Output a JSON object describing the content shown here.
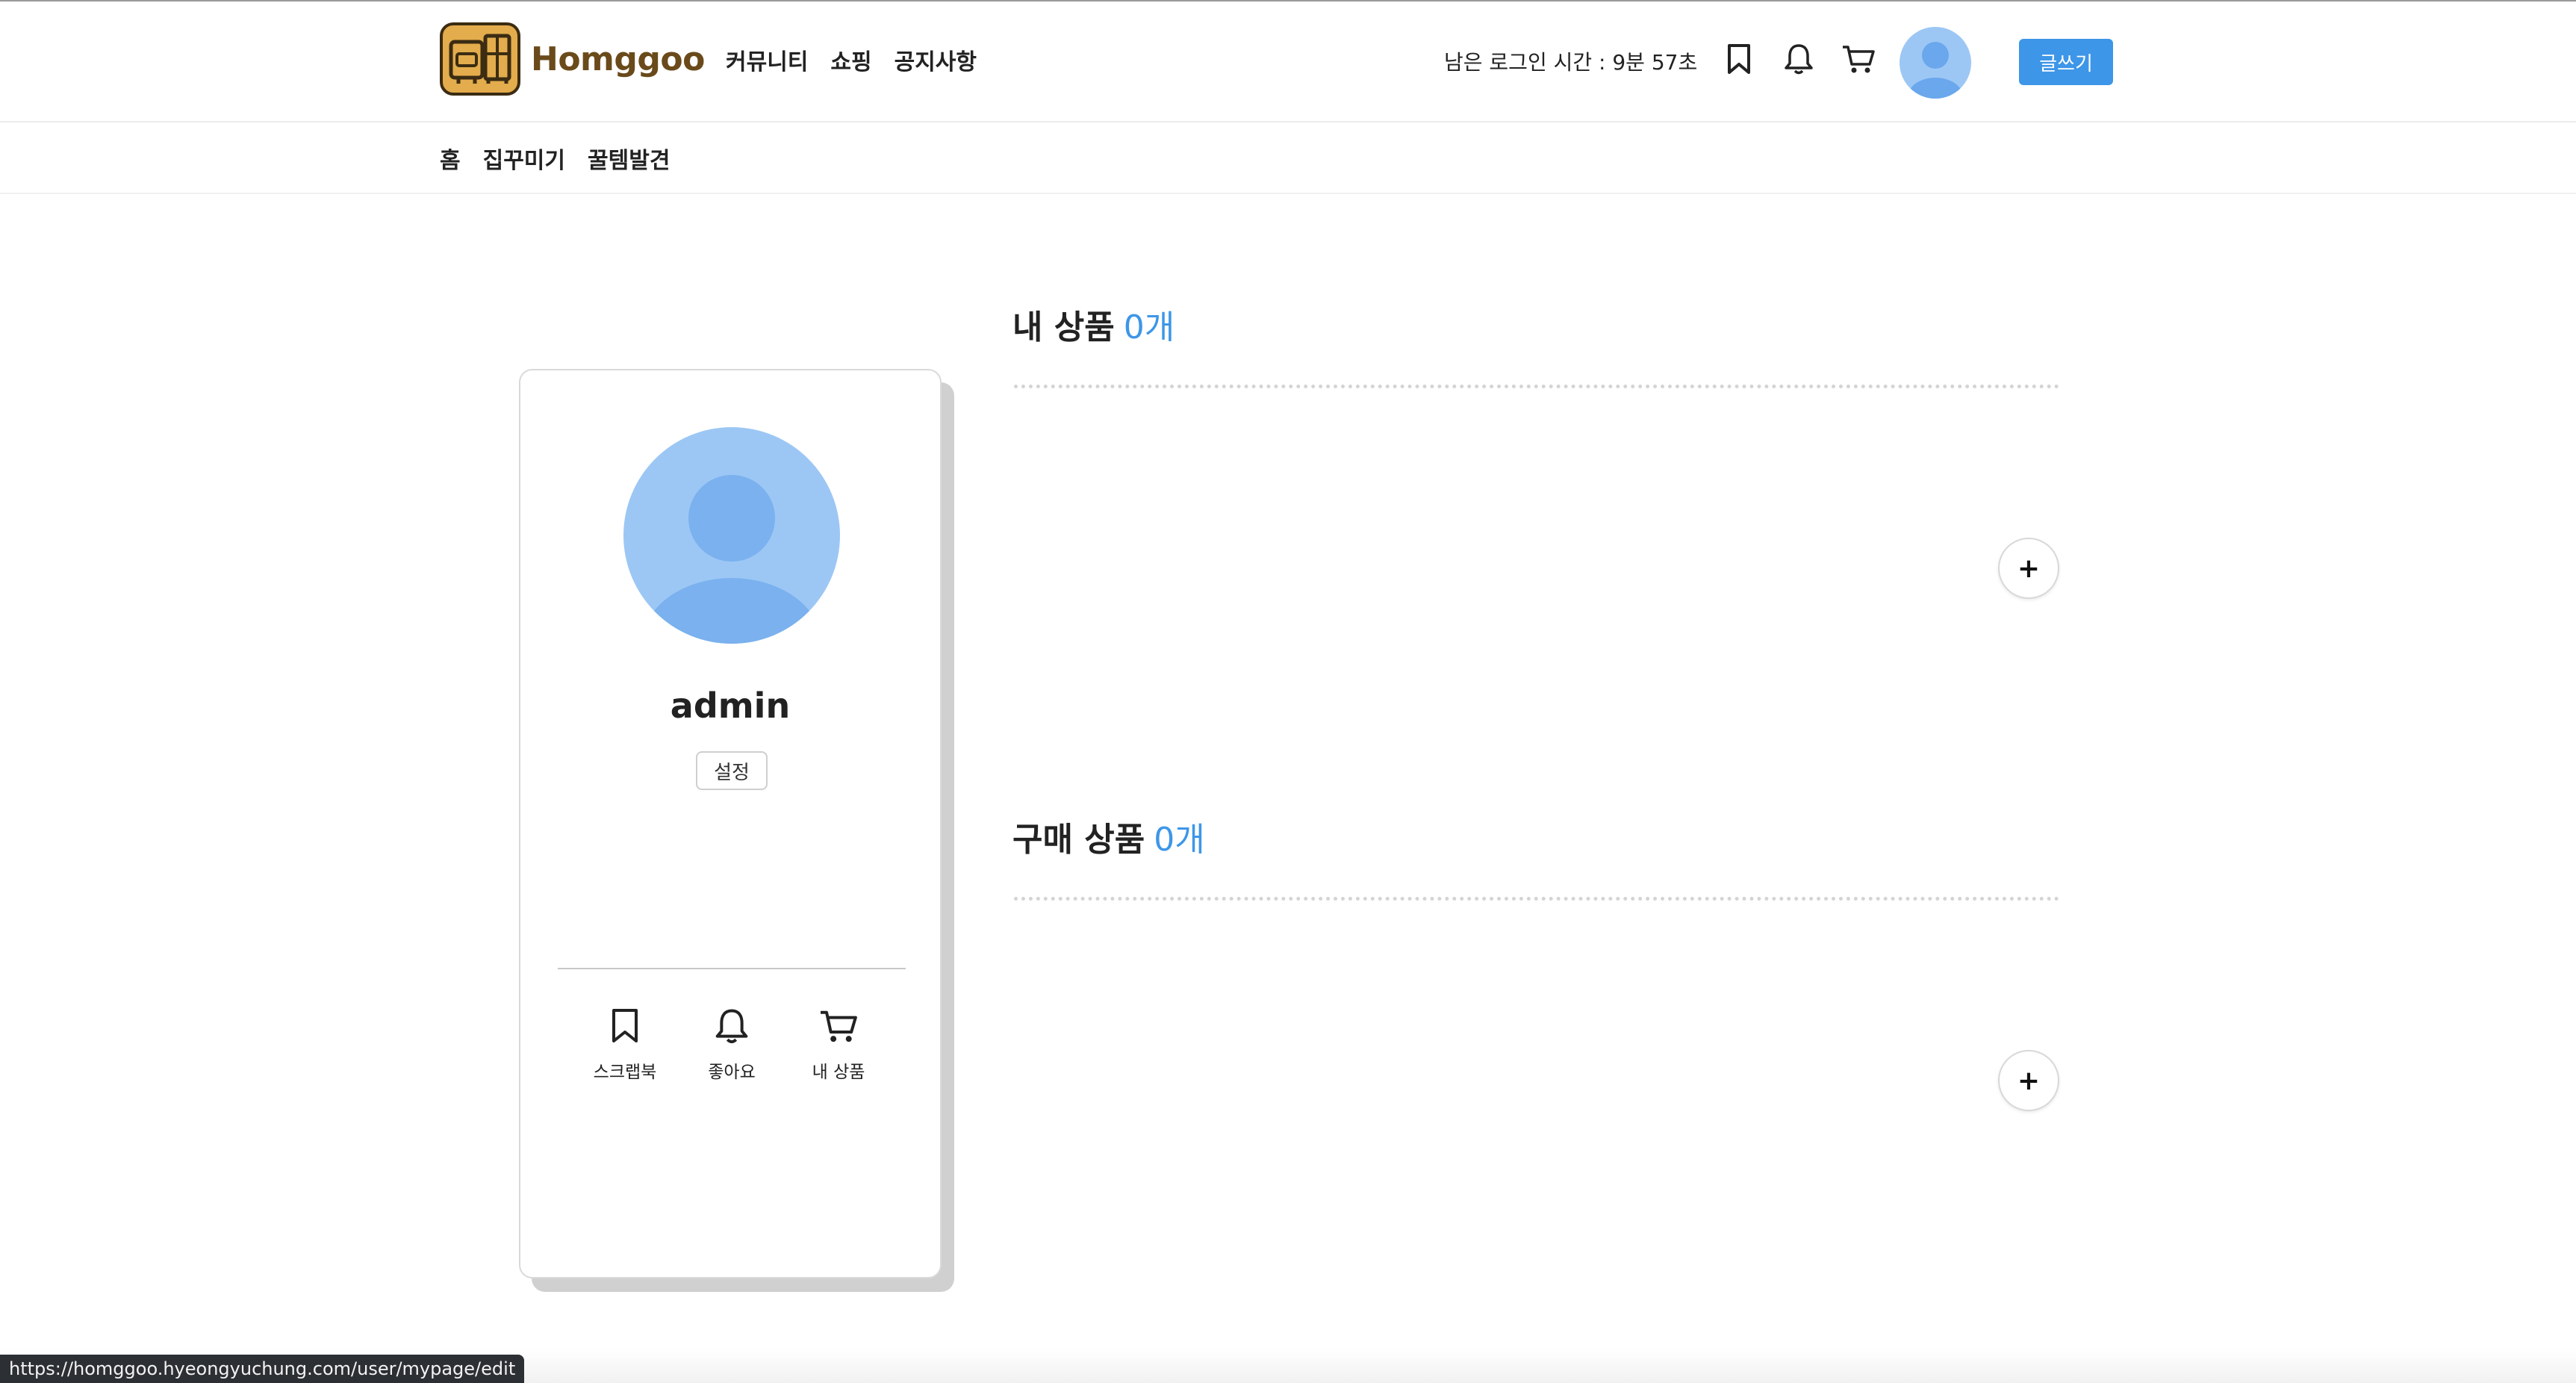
{
  "brand": {
    "name": "Homggoo"
  },
  "header": {
    "nav": [
      "커뮤니티",
      "쇼핑",
      "공지사항"
    ],
    "login_timer": "남은 로그인 시간 : 9분 57초",
    "write_label": "글쓰기"
  },
  "subnav": [
    "홈",
    "집꾸미기",
    "꿀템발견"
  ],
  "profile": {
    "username": "admin",
    "settings_label": "설정",
    "actions": [
      {
        "icon": "bookmark-icon",
        "label": "스크랩북"
      },
      {
        "icon": "bell-icon",
        "label": "좋아요"
      },
      {
        "icon": "cart-icon",
        "label": "내 상품"
      }
    ]
  },
  "sections": [
    {
      "title": "내 상품",
      "count": "0개",
      "add_label": "+"
    },
    {
      "title": "구매 상품",
      "count": "0개",
      "add_label": "+"
    }
  ],
  "status_url": "https://homggoo.hyeongyuchung.com/user/mypage/edit",
  "colors": {
    "accent": "#3d96e8",
    "logo_bg": "#e3ac4c",
    "logo_text": "#6a4a1a",
    "avatar_bg": "#9cc7f5"
  }
}
